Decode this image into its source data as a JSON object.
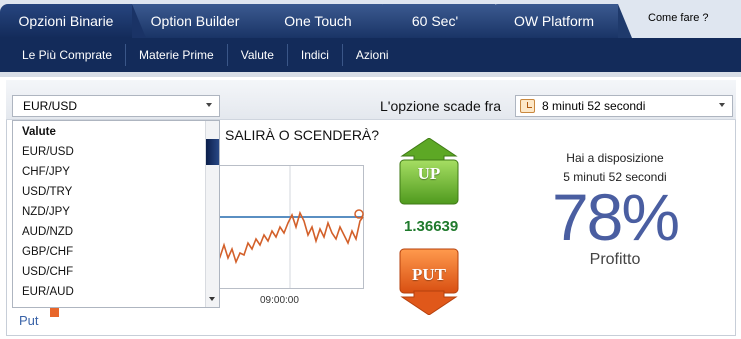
{
  "tabs": [
    {
      "label": "Opzioni Binarie",
      "active": true
    },
    {
      "label": "Option Builder",
      "active": false
    },
    {
      "label": "One Touch",
      "active": false
    },
    {
      "label": "60 Sec'",
      "active": false
    },
    {
      "label": "OW Platform",
      "active": false
    }
  ],
  "help_link": "Come fare ?",
  "subnav": [
    "Le Più Comprate",
    "Materie Prime",
    "Valute",
    "Indici",
    "Azioni"
  ],
  "asset_select": {
    "value": "EUR/USD",
    "options_header": "Valute",
    "options": [
      "EUR/USD",
      "CHF/JPY",
      "USD/TRY",
      "NZD/JPY",
      "AUD/NZD",
      "GBP/CHF",
      "USD/CHF",
      "EUR/AUD"
    ]
  },
  "expiry": {
    "label": "L'opzione scade fra",
    "value": "8 minuti 52 secondi"
  },
  "question": "SALIRÀ O SCENDERÀ?",
  "chart": {
    "time_label": "09:00:00",
    "legend_put": "Put"
  },
  "trade": {
    "up_label": "UP",
    "put_label": "PUT",
    "price": "1.36639"
  },
  "info": {
    "available_line1": "Hai a disposizione",
    "available_line2": "5 minuti 52 secondi",
    "percent": "78%",
    "profit_label": "Profitto"
  },
  "colors": {
    "nav": "#132b5a",
    "up": "#6bb52e",
    "put": "#e8662a",
    "percent": "#4a5ea1"
  }
}
